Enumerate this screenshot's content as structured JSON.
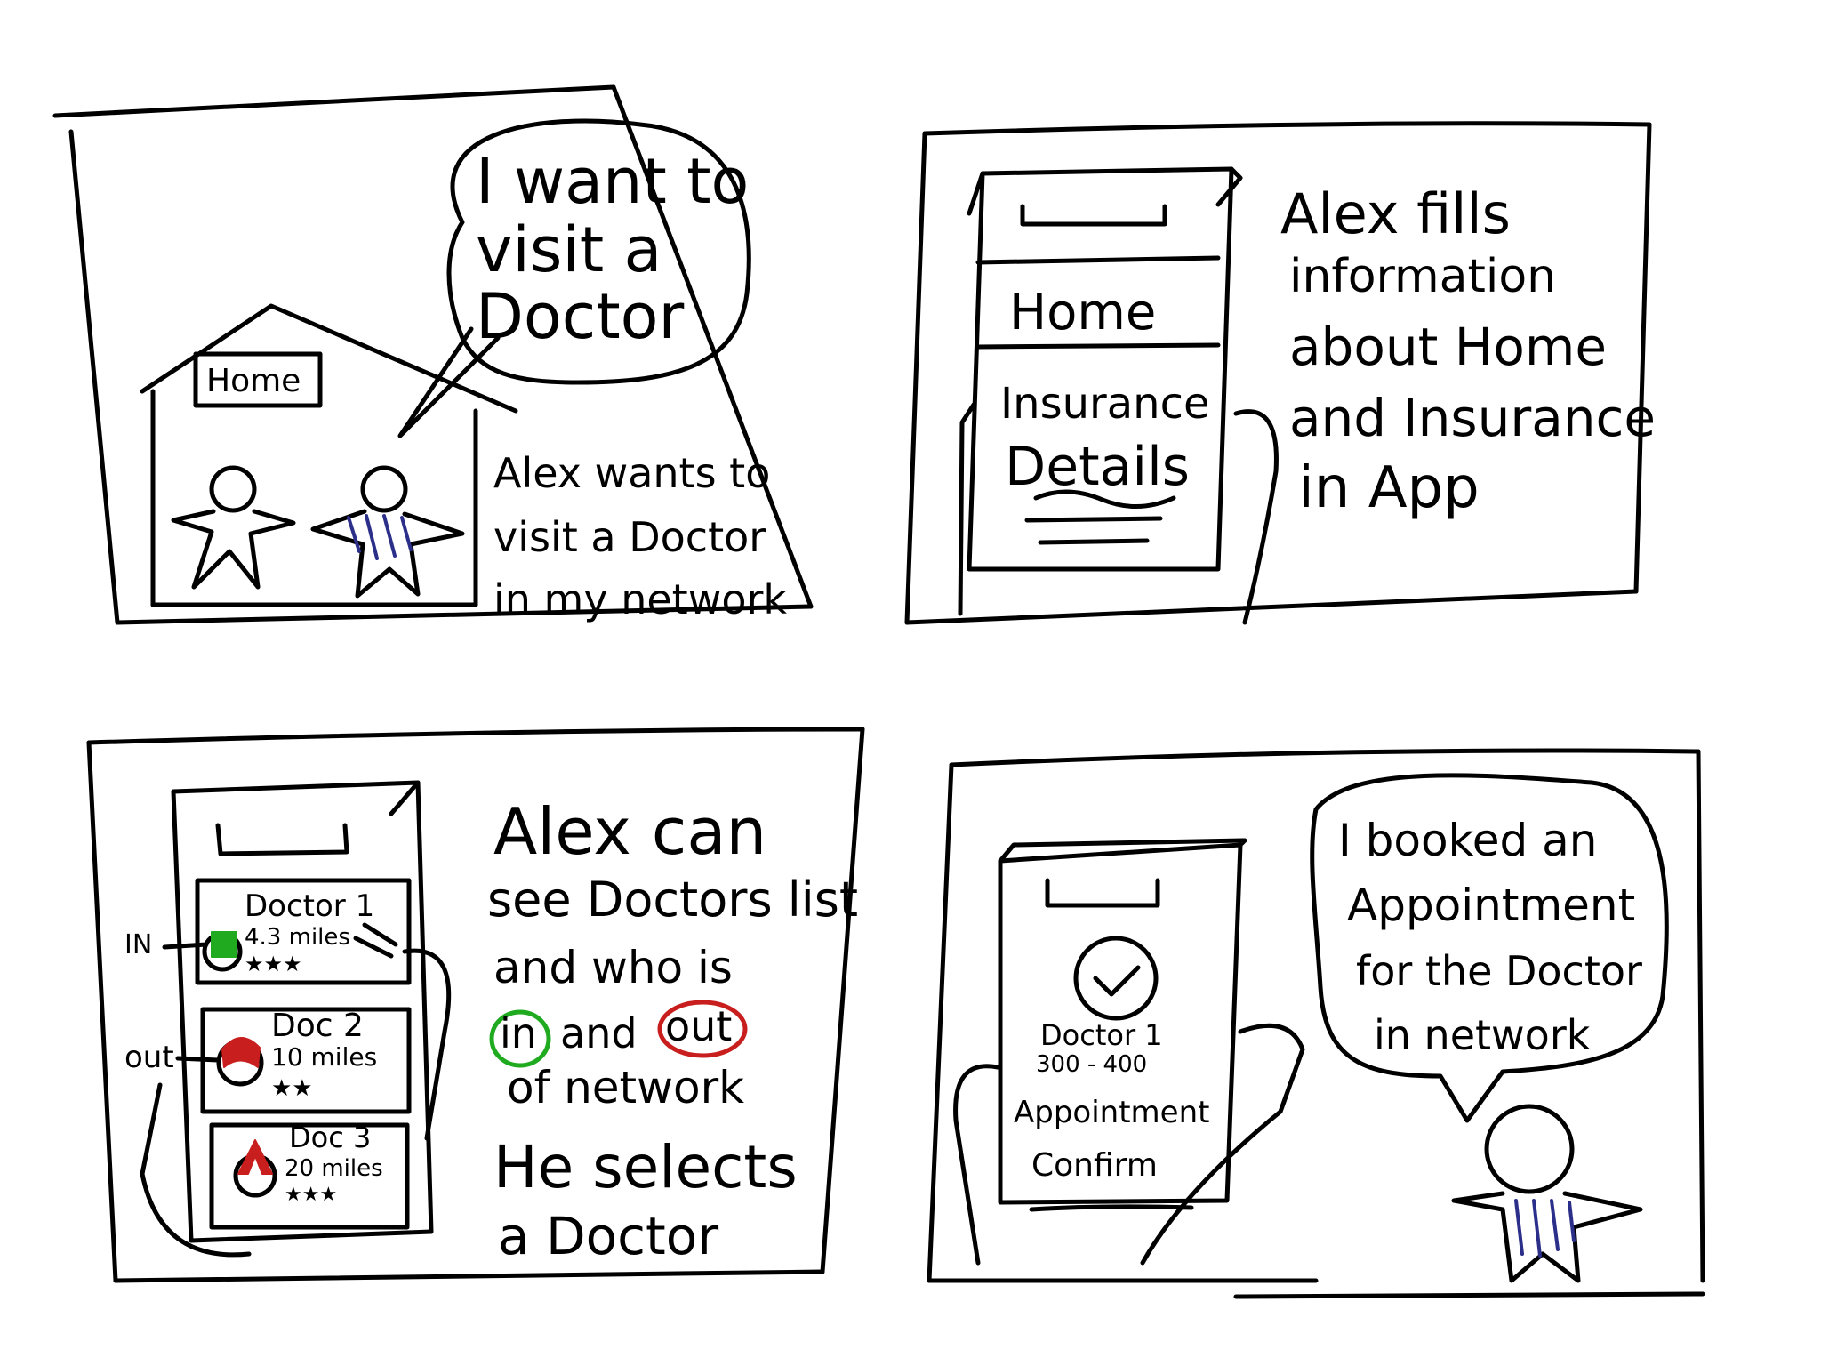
{
  "colors": {
    "ink": "#000000",
    "green": "#1faa1f",
    "red": "#c81e1e",
    "blue": "#2b2f8a"
  },
  "panel1": {
    "speech": [
      "I want to",
      "visit a",
      "Doctor"
    ],
    "house_sign": "Home",
    "caption": [
      "Alex wants to",
      "visit a Doctor",
      "in my network"
    ]
  },
  "panel2": {
    "phone_lines": [
      "Home",
      "Insurance",
      "Details"
    ],
    "caption": [
      "Alex fills",
      "information",
      "about Home",
      "and Insurance",
      "in App"
    ]
  },
  "panel3": {
    "doctors": [
      {
        "name": "Doctor 1",
        "distance": "4.3 miles",
        "rating": "★★★",
        "status": "IN"
      },
      {
        "name": "Doc 2",
        "distance": "10 miles",
        "rating": "★★",
        "status": "out"
      },
      {
        "name": "Doc 3",
        "distance": "20 miles",
        "rating": "★★★",
        "status": ""
      }
    ],
    "caption_1": [
      "Alex can",
      "see Doctors list",
      "and who is"
    ],
    "word_in": "in",
    "word_and": "and",
    "word_out": "out",
    "caption_2": [
      "of network"
    ],
    "caption_3": [
      "He selects",
      "a Doctor"
    ]
  },
  "panel4": {
    "phone_doctor": "Doctor 1",
    "phone_time": "300 - 400",
    "phone_label": [
      "Appointment",
      "Confirm"
    ],
    "speech": [
      "I booked an",
      "Appointment",
      "for the Doctor",
      "in network"
    ]
  }
}
